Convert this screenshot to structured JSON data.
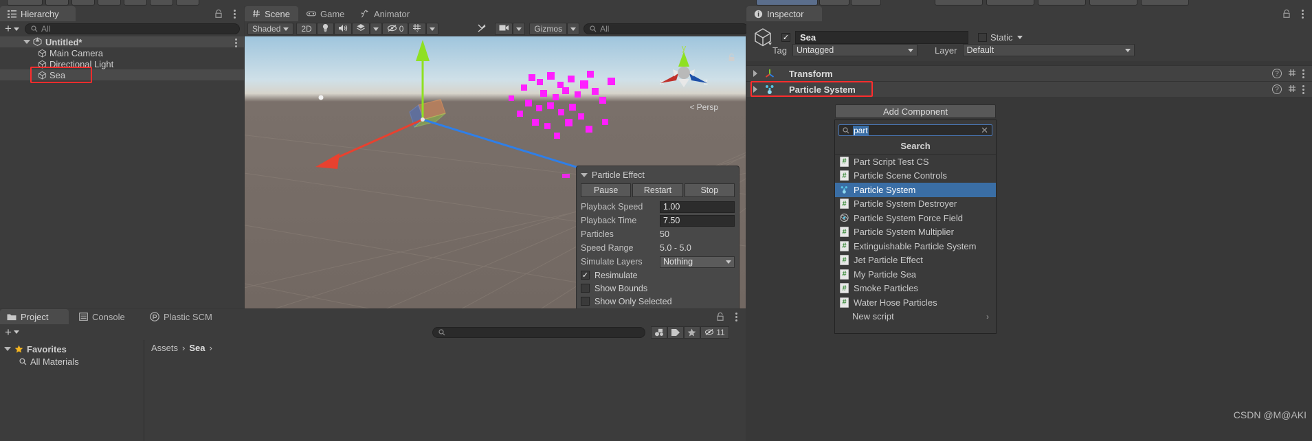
{
  "app": "Unity Editor",
  "hierarchy": {
    "tab_label": "Hierarchy",
    "tab_icon": "hierarchy-icon",
    "add_label": "+",
    "search_placeholder": "All",
    "items": [
      {
        "label": "Untitled*",
        "icon": "unity-scene-icon",
        "depth": 0,
        "expanded": true,
        "selected": false
      },
      {
        "label": "Main Camera",
        "icon": "gameobject-cube-icon",
        "depth": 1,
        "expanded": false,
        "selected": false
      },
      {
        "label": "Directional Light",
        "icon": "gameobject-cube-icon",
        "depth": 1,
        "expanded": false,
        "selected": false
      },
      {
        "label": "Sea",
        "icon": "gameobject-cube-icon",
        "depth": 1,
        "expanded": false,
        "selected": true
      }
    ]
  },
  "scene": {
    "tabs": [
      {
        "label": "Scene",
        "icon": "scene-hash-icon",
        "active": true
      },
      {
        "label": "Game",
        "icon": "game-controller-icon",
        "active": false
      },
      {
        "label": "Animator",
        "icon": "animator-icon",
        "active": false
      }
    ],
    "toolbar": {
      "shading_mode": "Shaded",
      "view_2d": "2D",
      "lighting_icon": "lighting-bulb-icon",
      "audio_icon": "audio-speaker-icon",
      "fx_icon": "effects-icon",
      "hidden_count": "0",
      "grid_icon": "grid-visibility-icon",
      "tools_icon": "scene-tools-icon",
      "camera_icon": "scene-camera-icon",
      "gizmos_label": "Gizmos",
      "search_placeholder": "All"
    },
    "gizmo": {
      "axis_x": "x",
      "axis_y": "y",
      "axis_z": "z",
      "projection": "Persp"
    }
  },
  "particle_effect": {
    "title": "Particle Effect",
    "buttons": [
      "Pause",
      "Restart",
      "Stop"
    ],
    "fields": [
      {
        "label": "Playback Speed",
        "value": "1.00",
        "kind": "input"
      },
      {
        "label": "Playback Time",
        "value": "7.50",
        "kind": "input"
      },
      {
        "label": "Particles",
        "value": "50",
        "kind": "text"
      },
      {
        "label": "Speed Range",
        "value": "5.0 - 5.0",
        "kind": "text"
      },
      {
        "label": "Simulate Layers",
        "value": "Nothing",
        "kind": "select"
      }
    ],
    "checkboxes": [
      {
        "label": "Resimulate",
        "checked": true
      },
      {
        "label": "Show Bounds",
        "checked": false
      },
      {
        "label": "Show Only Selected",
        "checked": false
      }
    ]
  },
  "inspector": {
    "tab_label": "Inspector",
    "tab_icon": "info-circle-icon",
    "object_name": "Sea",
    "object_enabled": true,
    "static_label": "Static",
    "tag_label": "Tag",
    "tag_value": "Untagged",
    "layer_label": "Layer",
    "layer_value": "Default",
    "components": [
      {
        "name": "Transform",
        "icon": "transform-axis-icon",
        "highlighted": false
      },
      {
        "name": "Particle System",
        "icon": "particle-system-icon",
        "highlighted": true
      }
    ],
    "add_component_label": "Add Component",
    "add_component_search": {
      "value": "part",
      "clear_icon": "clear-x-icon",
      "search_icon": "search-icon"
    },
    "search_header": "Search",
    "results": [
      {
        "label": "Part Script Test CS",
        "icon": "cs-script-icon",
        "selected": false
      },
      {
        "label": "Particle Scene Controls",
        "icon": "cs-script-icon",
        "selected": false
      },
      {
        "label": "Particle System",
        "icon": "particle-system-icon",
        "selected": true
      },
      {
        "label": "Particle System Destroyer",
        "icon": "cs-script-icon",
        "selected": false
      },
      {
        "label": "Particle System Force Field",
        "icon": "force-field-icon",
        "selected": false
      },
      {
        "label": "Particle System Multiplier",
        "icon": "cs-script-icon",
        "selected": false
      },
      {
        "label": "Extinguishable Particle System",
        "icon": "cs-script-icon",
        "selected": false
      },
      {
        "label": "Jet Particle Effect",
        "icon": "cs-script-icon",
        "selected": false
      },
      {
        "label": "My Particle Sea",
        "icon": "cs-script-icon",
        "selected": false
      },
      {
        "label": "Smoke Particles",
        "icon": "cs-script-icon",
        "selected": false
      },
      {
        "label": "Water Hose Particles",
        "icon": "cs-script-icon",
        "selected": false
      },
      {
        "label": "New script",
        "icon": "none",
        "selected": false,
        "submenu": "›"
      }
    ]
  },
  "project": {
    "tabs": [
      {
        "label": "Project",
        "icon": "folder-icon",
        "active": true
      },
      {
        "label": "Console",
        "icon": "console-icon",
        "active": false
      },
      {
        "label": "Plastic SCM",
        "icon": "plastic-scm-icon",
        "active": false
      }
    ],
    "add_label": "+",
    "search_placeholder": "",
    "hidden_count": "11",
    "tree": [
      {
        "label": "Favorites",
        "icon": "star-icon",
        "depth": 0,
        "bold": true,
        "expanded": true
      },
      {
        "label": "All Materials",
        "icon": "search-icon",
        "depth": 1,
        "bold": false,
        "expanded": false
      }
    ],
    "breadcrumb": [
      "Assets",
      "Sea"
    ]
  },
  "watermark": "CSDN @M@AKI",
  "colors": {
    "accent_selection": "#3a6ea5",
    "highlight_red": "#ff2d2d",
    "panel_bg": "#3c3c3c",
    "axis_x": "#e8412f",
    "axis_y": "#8fe022",
    "axis_z": "#2f7fe8",
    "particle_pink": "#ff00ff"
  }
}
